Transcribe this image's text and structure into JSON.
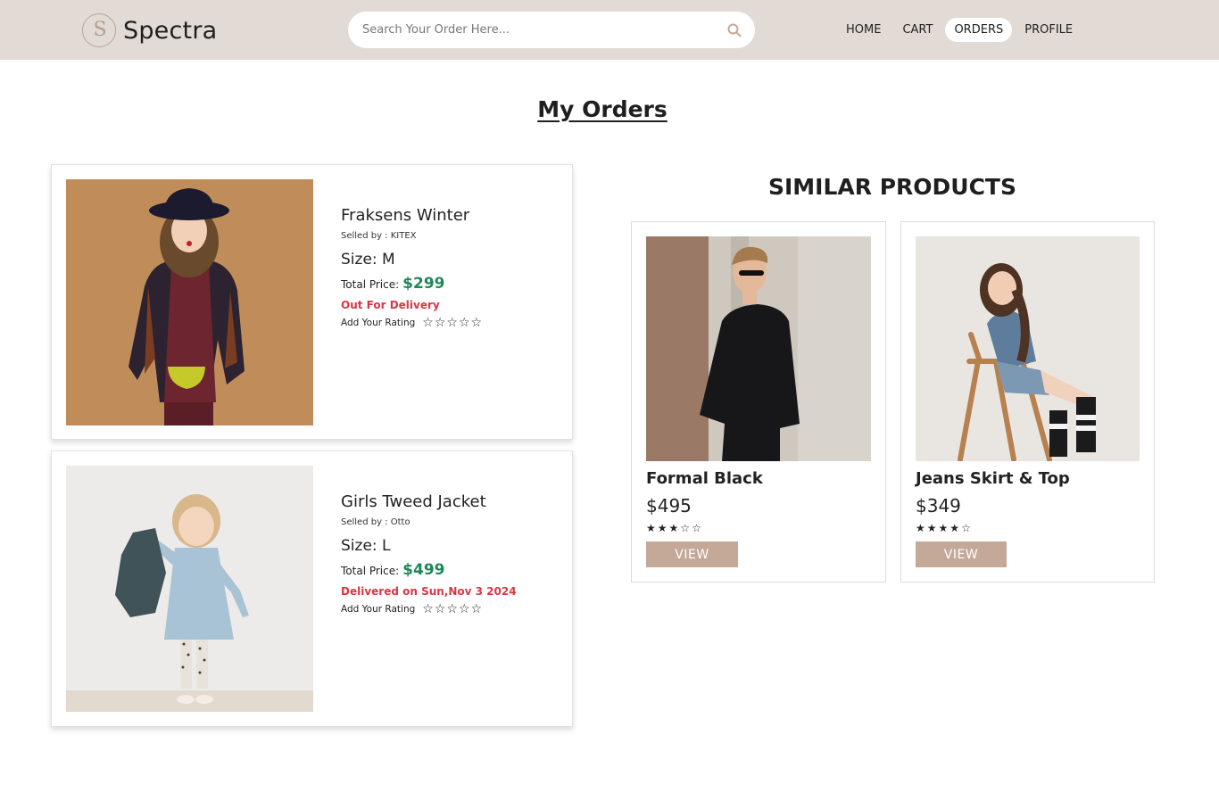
{
  "header": {
    "brand_name": "Spectra",
    "logo_letter": "S",
    "search": {
      "placeholder": "Search Your Order Here..."
    },
    "nav": [
      {
        "label": "HOME",
        "active": false
      },
      {
        "label": "CART",
        "active": false
      },
      {
        "label": "ORDERS",
        "active": true
      },
      {
        "label": "PROFILE",
        "active": false
      }
    ]
  },
  "page_title": "My Orders",
  "orders": [
    {
      "name": "Fraksens Winter",
      "seller": "Selled by : KITEX",
      "size": "Size: M",
      "price_label": "Total Price:",
      "price": "$299",
      "status": "Out For Delivery",
      "rating_label": "Add Your Rating",
      "rating_stars": [
        "☆",
        "☆",
        "☆",
        "☆",
        "☆"
      ]
    },
    {
      "name": "Girls Tweed Jacket",
      "seller": "Selled by : Otto",
      "size": "Size: L",
      "price_label": "Total Price:",
      "price": "$499",
      "status": "Delivered on Sun,Nov 3 2024",
      "rating_label": "Add Your Rating",
      "rating_stars": [
        "☆",
        "☆",
        "☆",
        "☆",
        "☆"
      ]
    }
  ],
  "similar": {
    "title": "SIMILAR PRODUCTS",
    "products": [
      {
        "name": "Formal Black",
        "price": "$495",
        "stars": [
          "★",
          "★",
          "★",
          "☆",
          "☆"
        ],
        "button": "VIEW"
      },
      {
        "name": "Jeans Skirt & Top",
        "price": "$349",
        "stars": [
          "★",
          "★",
          "★",
          "★",
          "☆"
        ],
        "button": "VIEW"
      }
    ]
  },
  "colors": {
    "navbar_bg": "#e2dbd5",
    "price_green": "#20875a",
    "status_red": "#dc3545",
    "button_tan": "#c4a898"
  },
  "icons": {
    "search": "search-icon",
    "logo": "logo-icon",
    "star_empty": "star-outline-icon",
    "star_filled": "star-filled-icon"
  }
}
